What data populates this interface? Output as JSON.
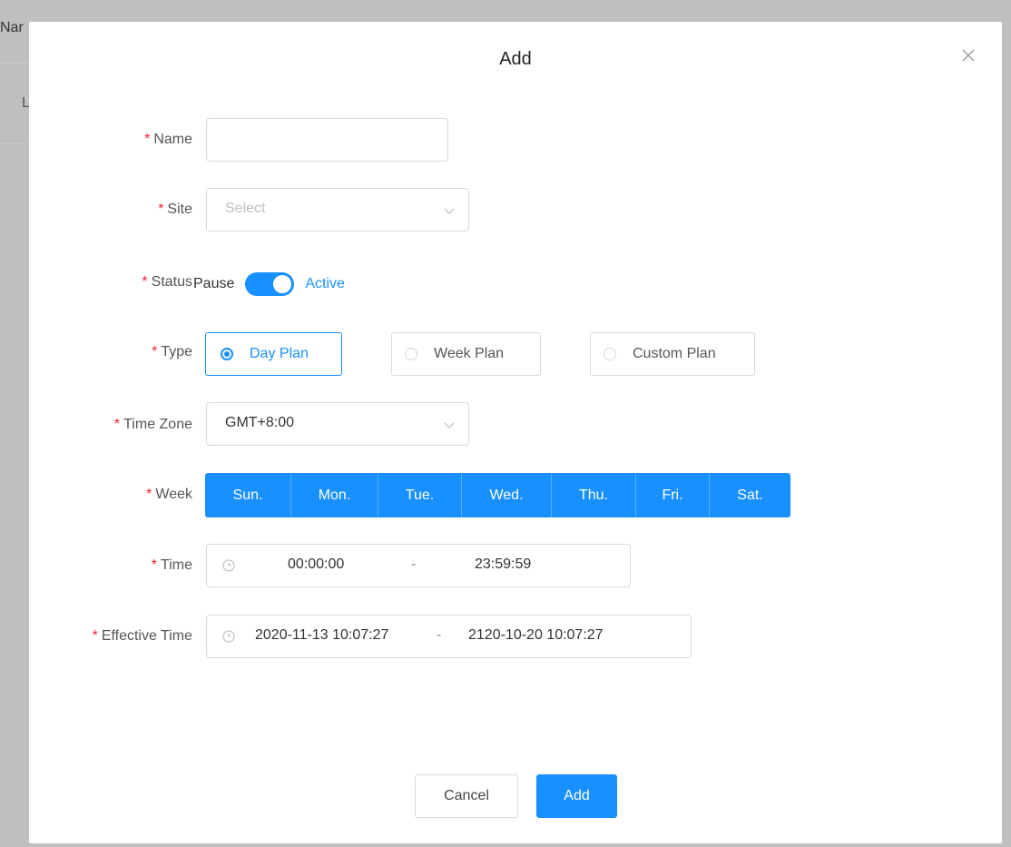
{
  "background": {
    "header_text": "Nar",
    "row_text": "L"
  },
  "modal": {
    "title": "Add",
    "close_icon": "close-icon"
  },
  "form": {
    "required_mark": "*",
    "name": {
      "label": "Name",
      "value": ""
    },
    "site": {
      "label": "Site",
      "placeholder": "Select"
    },
    "status": {
      "label": "Status",
      "off_label": "Pause",
      "on_label": "Active",
      "checked": true
    },
    "type": {
      "label": "Type",
      "options": [
        "Day Plan",
        "Week Plan",
        "Custom Plan"
      ],
      "selected": "Day Plan"
    },
    "time_zone": {
      "label": "Time Zone",
      "value": "GMT+8:00"
    },
    "week": {
      "label": "Week",
      "days": [
        "Sun.",
        "Mon.",
        "Tue.",
        "Wed.",
        "Thu.",
        "Fri.",
        "Sat."
      ]
    },
    "time": {
      "label": "Time",
      "start": "00:00:00",
      "separator": "-",
      "end": "23:59:59"
    },
    "effective_time": {
      "label": "Effective Time",
      "start": "2020-11-13 10:07:27",
      "separator": "-",
      "end": "2120-10-20 10:07:27"
    }
  },
  "footer": {
    "cancel_label": "Cancel",
    "add_label": "Add"
  },
  "colors": {
    "primary": "#1890ff",
    "required": "#f5222d",
    "overlay": "#7f7f7f"
  }
}
